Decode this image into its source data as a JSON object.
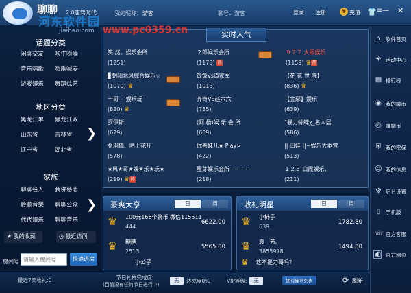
{
  "app": {
    "name": "聊聊",
    "version": "2.0座驾时代",
    "watermark_main": "河东软件园",
    "watermark_site": "www.pc0359.cn",
    "watermark_small": "jiaibao.com"
  },
  "topbar": {
    "nick_label": "我的昵称：",
    "nick_value": "游客",
    "account_label": "聊号：游客",
    "login": "登录",
    "register": "注册",
    "recharge": "充值"
  },
  "left": {
    "topic_title": "话题分类",
    "topics": [
      "闲聊交友",
      "吹牛唠嗑",
      "音乐唱歌",
      "嗨歌喊麦",
      "游戏娱乐",
      "舞蹈综艺"
    ],
    "region_title": "地区分类",
    "regions": [
      "黑龙江单",
      "黑龙江双",
      "山东省",
      "吉林省",
      "辽宁省",
      "湖北省"
    ],
    "family_title": "家族",
    "families": [
      "聊聊名人",
      "我佛慈悲",
      "聆聽音樂",
      "聊聊公众",
      "代代娱乐",
      "聊聊音乐"
    ],
    "favorites": "我的收藏",
    "recent": "最近访问",
    "room_label": "房间号",
    "room_placeholder": "请输入房间号",
    "quick_enter": "快速进房"
  },
  "popular": {
    "title": "实时人气",
    "rooms": [
      {
        "name": "笑 然。娱乐会所",
        "count": "(1251)"
      },
      {
        "name": "２郎娱乐会所",
        "count": "(1173)"
      },
      {
        "name": "９７７ 大眼娱乐",
        "count": "(1159)"
      },
      {
        "name": "▊朝阳北风综合娱乐☆",
        "count": "(1070)"
      },
      {
        "name": "饭饭vs道家军",
        "count": "(1013)"
      },
      {
        "name": "【花 花 世 院】",
        "count": "(836)"
      },
      {
        "name": "一哥~˜娱乐玩˜",
        "count": "(820)"
      },
      {
        "name": "齐奇VS赵六六",
        "count": "(735)"
      },
      {
        "name": "【金鄢】娱乐",
        "count": "(639)"
      },
      {
        "name": "罗伊斯",
        "count": "(629)"
      },
      {
        "name": "(阿 杨)娱 乐 会 所",
        "count": "(609)"
      },
      {
        "name": "˜暴力蝴蝶χ_名人居",
        "count": "(586)"
      },
      {
        "name": "张羽僑、陌上花开",
        "count": "(578)"
      },
      {
        "name": "你善妹儿★ Play>",
        "count": "(422)"
      },
      {
        "name": "|| 田娃 ||~娱乐大本营",
        "count": "(513)"
      },
      {
        "name": "★风★哥★娱★乐★玩★",
        "count": "(219)"
      },
      {
        "name": "蜜芽娱乐会所~~~~~",
        "count": "(218)"
      },
      {
        "name": "１２５ 白霞娱乐、",
        "count": "(211)"
      }
    ]
  },
  "rich": {
    "title": "豪爽大亨",
    "tab_day": "日",
    "tab_week": "周",
    "rows": [
      {
        "name": "100元166个聊币 微信115511",
        "id": "444",
        "value": "6622.00"
      },
      {
        "name": "糖糖",
        "id": "2513",
        "value": "5565.00"
      },
      {
        "name": "小公子",
        "id": "",
        "value": ""
      }
    ]
  },
  "stars": {
    "title": "收礼明星",
    "tab_day": "日",
    "tab_week": "周",
    "rows": [
      {
        "name": "小柿子",
        "id": "639",
        "value": "1782.80"
      },
      {
        "name": "袁　芳。",
        "id": "3855978",
        "value": "1494.80"
      },
      {
        "name": "这不是刀哥吗？",
        "id": "",
        "value": ""
      }
    ]
  },
  "sidebar": {
    "items": [
      "软件首页",
      "活动中心",
      "排行榜",
      "我的聊币",
      "赚聊币",
      "我的密保",
      "我的信息",
      "后台设置",
      "手机版",
      "官方客服",
      "官方网页"
    ]
  },
  "bottombar": {
    "gift_count": "最近7天收礼:0",
    "gift_title": "节日礼物完成度:",
    "gift_sub": "(目前没有任何节日进行中)",
    "gift_badge": "无",
    "rate_label": "达成度0%",
    "vip_label": "VIP等级:",
    "vip_badge": "无",
    "seat_button": "拥有座驾列表",
    "refresh": "刷新"
  }
}
